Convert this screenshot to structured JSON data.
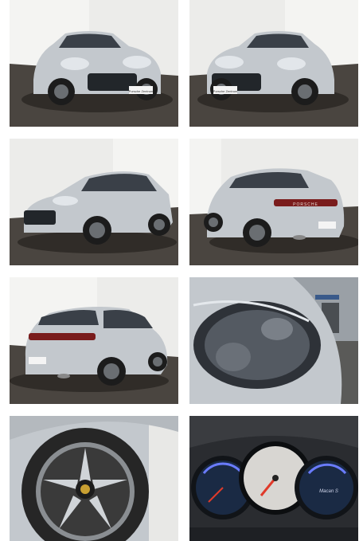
{
  "gallery": {
    "photos": [
      {
        "subject": "front-left-three-quarter",
        "icon": "car-photo-icon",
        "dealer_plate": "Porsche Zentrum"
      },
      {
        "subject": "front-right-three-quarter",
        "icon": "car-photo-icon",
        "dealer_plate": "Porsche Zentrum"
      },
      {
        "subject": "left-side-three-quarter",
        "icon": "car-photo-icon"
      },
      {
        "subject": "rear-left-three-quarter",
        "icon": "car-photo-icon",
        "badge": "PORSCHE"
      },
      {
        "subject": "rear-right-three-quarter",
        "icon": "car-photo-icon"
      },
      {
        "subject": "headlight-closeup",
        "icon": "headlight-photo-icon"
      },
      {
        "subject": "wheel-closeup",
        "icon": "wheel-photo-icon"
      },
      {
        "subject": "instrument-cluster",
        "icon": "dashboard-photo-icon",
        "cluster_label": "Macan S"
      }
    ]
  },
  "colors": {
    "car_silver": "#c3c8cd",
    "studio_wall": "#eeeeec",
    "studio_floor": "#4a4540",
    "window_dark": "#3a4048",
    "tail_light": "#7a1c1c"
  }
}
